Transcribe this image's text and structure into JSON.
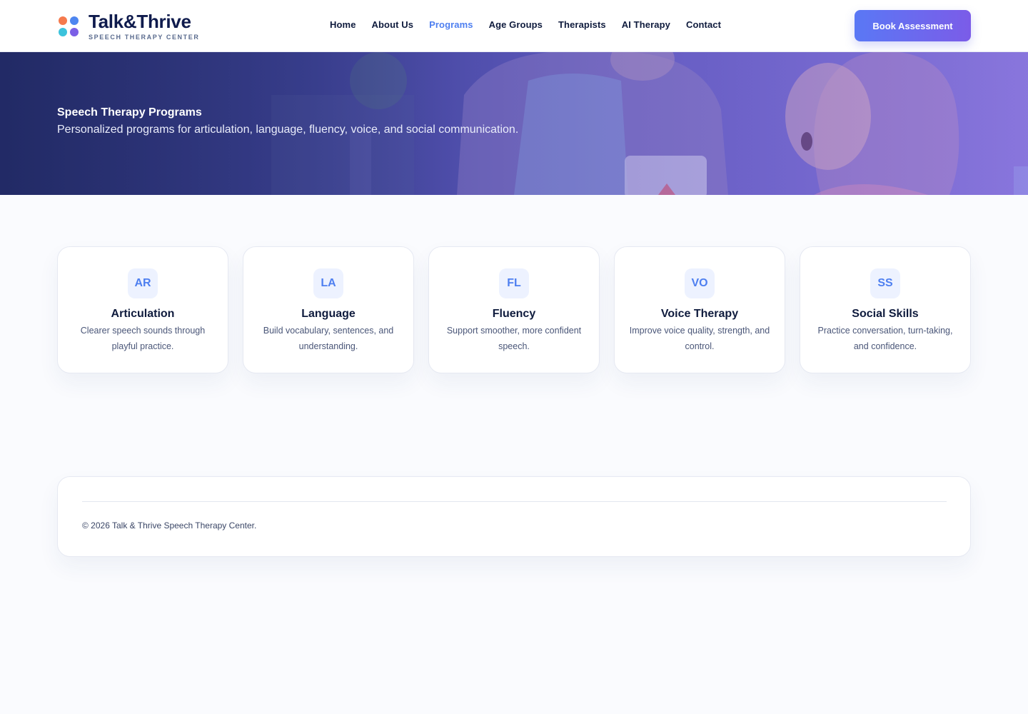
{
  "brand": {
    "name": "Talk&Thrive",
    "tagline": "SPEECH THERAPY CENTER",
    "colors": {
      "orange": "#f57a4d",
      "blue": "#4e86f0",
      "cyan": "#3cc3dc",
      "purple": "#7b5fe6"
    }
  },
  "nav": {
    "items": [
      {
        "label": "Home",
        "active": false
      },
      {
        "label": "About Us",
        "active": false
      },
      {
        "label": "Programs",
        "active": true
      },
      {
        "label": "Age Groups",
        "active": false
      },
      {
        "label": "Therapists",
        "active": false
      },
      {
        "label": "AI Therapy",
        "active": false
      },
      {
        "label": "Contact",
        "active": false
      }
    ],
    "cta_label": "Book Assessment"
  },
  "hero": {
    "title": "Speech Therapy Programs",
    "subtitle": "Personalized programs for articulation, language, fluency, voice, and social communication."
  },
  "programs": [
    {
      "code": "AR",
      "title": "Articulation",
      "desc": "Clearer speech sounds through playful practice."
    },
    {
      "code": "LA",
      "title": "Language",
      "desc": "Build vocabulary, sentences, and understanding."
    },
    {
      "code": "FL",
      "title": "Fluency",
      "desc": "Support smoother, more confident speech."
    },
    {
      "code": "VO",
      "title": "Voice Therapy",
      "desc": "Improve voice quality, strength, and control."
    },
    {
      "code": "SS",
      "title": "Social Skills",
      "desc": "Practice conversation, turn-taking, and confidence."
    }
  ],
  "footer": {
    "copyright": "© 2026 Talk & Thrive Speech Therapy Center."
  },
  "accent": "#4e7ff0"
}
